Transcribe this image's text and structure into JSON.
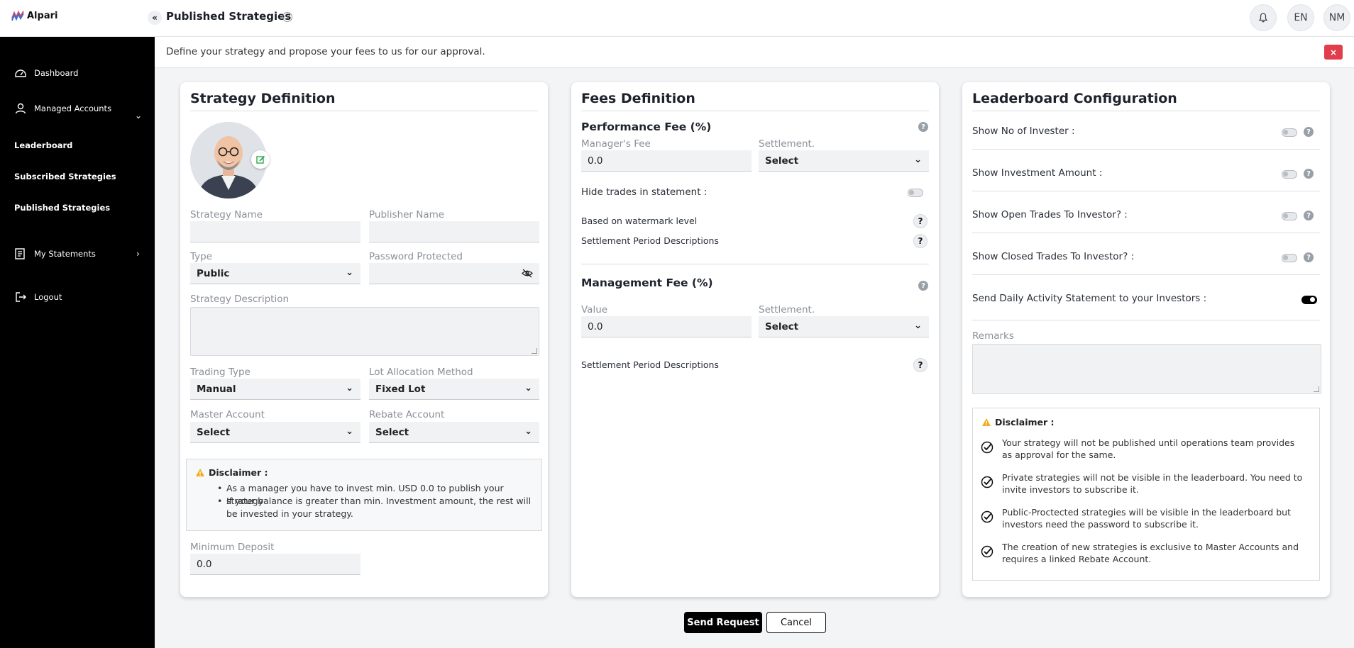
{
  "header": {
    "logo_text": "Alpari",
    "title": "Published Strategies",
    "info_icon": "info-icon",
    "bell_icon": "bell-icon",
    "language": "EN",
    "user_initials": "NM"
  },
  "sidebar": {
    "dashboard": "Dashboard",
    "managed_accounts": "Managed Accounts",
    "leaderboard": "Leaderboard",
    "subscribed_strategies": "Subscribed Strategies",
    "published_strategies": "Published Strategies",
    "my_statements": "My Statements",
    "logout": "Logout"
  },
  "notice": {
    "text": "Define your strategy and propose your fees to us for our approval.",
    "close": "×"
  },
  "strategy": {
    "title": "Strategy Definition",
    "strategy_name_label": "Strategy Name",
    "strategy_name_value": "",
    "publisher_name_label": "Publisher Name",
    "publisher_name_value": "",
    "type_label": "Type",
    "type_value": "Public",
    "password_label": "Password Protected",
    "password_value": "",
    "description_label": "Strategy Description",
    "trading_type_label": "Trading Type",
    "trading_type_value": "Manual",
    "lot_allocation_label": "Lot Allocation Method",
    "lot_allocation_value": "Fixed Lot",
    "master_account_label": "Master Account",
    "master_account_value": "Select",
    "rebate_account_label": "Rebate Account",
    "rebate_account_value": "Select",
    "disclaimer_title": "Disclaimer :",
    "disclaimer_items": [
      "As a manager you have to invest min. USD 0.0 to publish your strategy",
      "If your balance is greater than min. Investment amount, the rest will be invested in your strategy."
    ],
    "min_deposit_label": "Minimum Deposit",
    "min_deposit_value": "0.0"
  },
  "fees": {
    "title": "Fees Definition",
    "performance_title": "Performance Fee (%)",
    "managers_fee_label": "Manager's Fee",
    "managers_fee_value": "0.0",
    "settlement_label": "Settlement.",
    "settlement_value": "Select",
    "hide_trades_label": "Hide trades in statement :",
    "hide_trades_on": false,
    "watermark_label": "Based on watermark level",
    "settlement_desc_label": "Settlement Period Descriptions",
    "management_title": "Management Fee (%)",
    "value_label": "Value",
    "value_value": "0.0",
    "mgmt_settlement_label": "Settlement.",
    "mgmt_settlement_value": "Select",
    "mgmt_settlement_desc_label": "Settlement Period Descriptions"
  },
  "leaderboard": {
    "title": "Leaderboard Configuration",
    "toggles": [
      {
        "label": "Show No of Invester :",
        "on": false
      },
      {
        "label": "Show Investment Amount :",
        "on": false
      },
      {
        "label": "Show Open Trades To Investor? :",
        "on": false
      },
      {
        "label": "Show Closed Trades To Investor? :",
        "on": false
      },
      {
        "label": "Send Daily Activity Statement to your Investors :",
        "on": true
      }
    ],
    "remarks_label": "Remarks",
    "disclaimer_title": "Disclaimer :",
    "disclaimer_items": [
      "Your strategy will not be published until operations team provides as approval for the same.",
      "Private strategies will not be visible in the leaderboard. You need to invite investors to subscribe it.",
      "Public-Proctected strategies will be visible in the leaderboard but investors need the password to subscribe it.",
      "The creation of new strategies is exclusive to Master Accounts and requires a linked Rebate Account."
    ]
  },
  "actions": {
    "send_request": "Send Request",
    "cancel": "Cancel"
  },
  "colors": {
    "sidebar_bg": "#000000",
    "primary_button": "#000000",
    "close_red": "#e23d4a",
    "edit_green": "#2fa84f",
    "warning_amber": "#f0ad1b"
  }
}
